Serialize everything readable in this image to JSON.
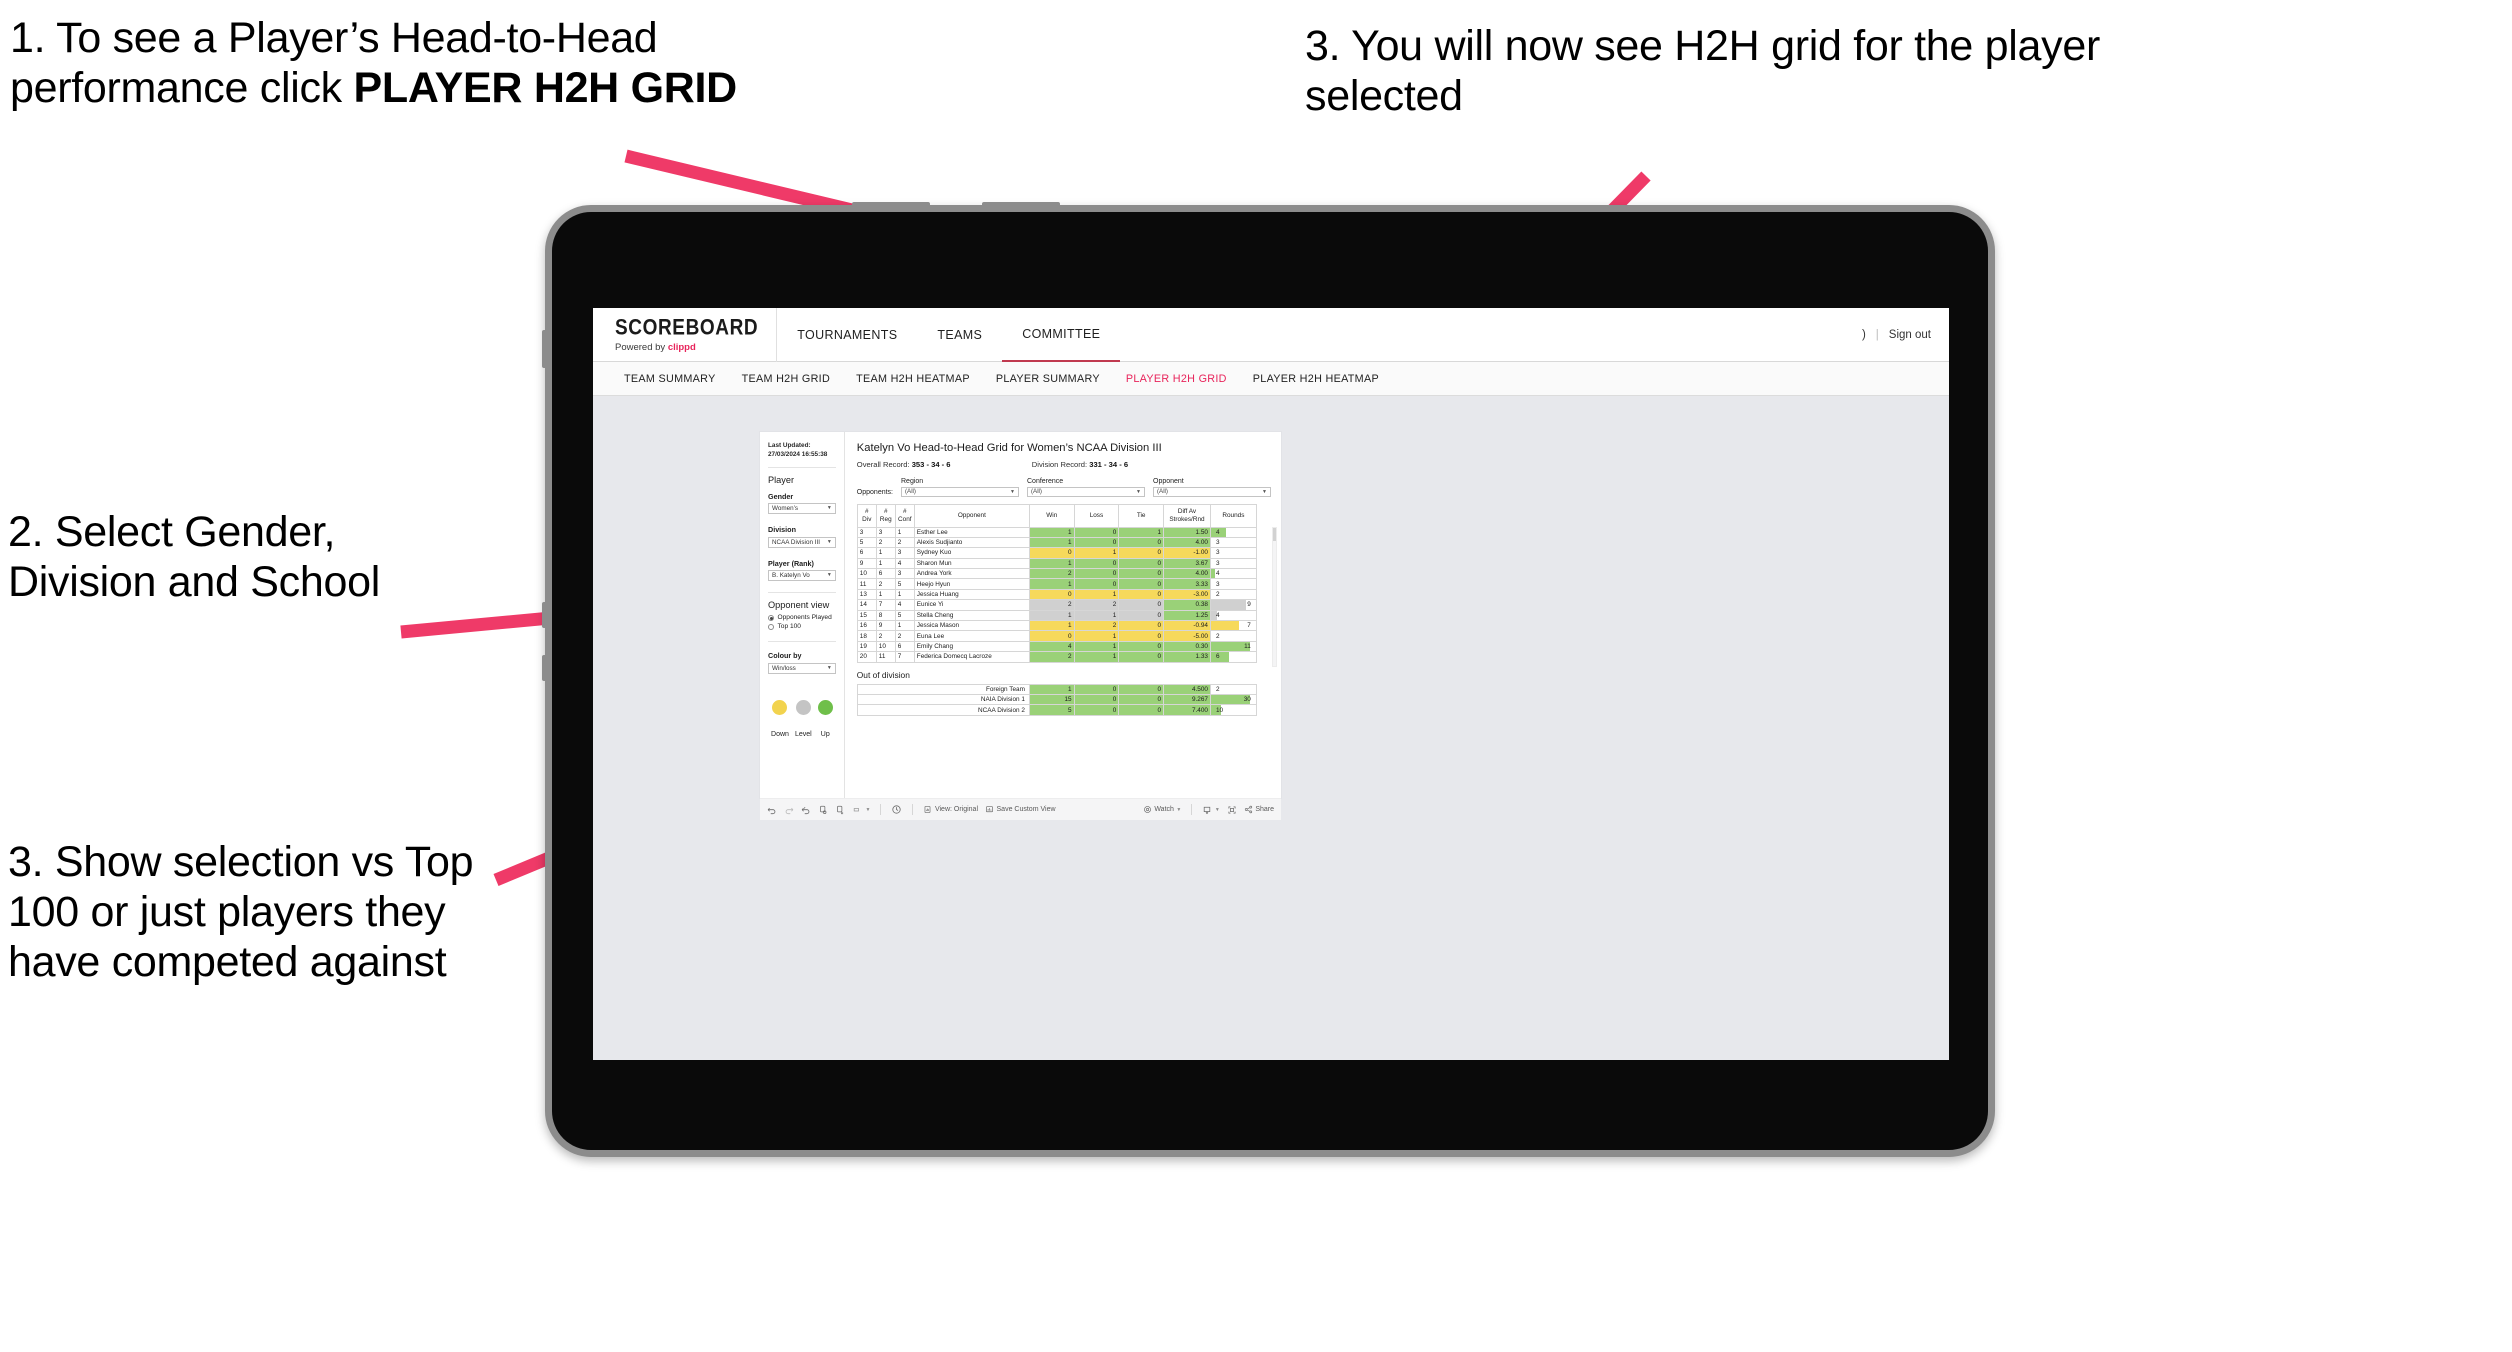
{
  "annotations": [
    {
      "id": "step1",
      "pre": "1. To see a Player’s Head-to-Head performance click ",
      "bold": "PLAYER H2H GRID"
    },
    {
      "id": "step2",
      "text": "2. Select Gender, Division and School"
    },
    {
      "id": "step3",
      "text": "3. Show selection vs Top 100 or just players they have competed against"
    },
    {
      "id": "step4",
      "text": "3. You will now see H2H grid for the player selected"
    }
  ],
  "arrow_color": "#ef3a68",
  "app": {
    "brand": {
      "name": "SCOREBOARD",
      "powered_prefix": "Powered by ",
      "powered_accent": "clippd"
    },
    "topnav": [
      {
        "label": "TOURNAMENTS",
        "active": false
      },
      {
        "label": "TEAMS",
        "active": false
      },
      {
        "label": "COMMITTEE",
        "active": true
      }
    ],
    "account": {
      "user": ")",
      "divider": "|",
      "signout": "Sign out"
    },
    "subnav": [
      {
        "label": "TEAM SUMMARY",
        "active": false
      },
      {
        "label": "TEAM H2H GRID",
        "active": false
      },
      {
        "label": "TEAM H2H HEATMAP",
        "active": false
      },
      {
        "label": "PLAYER SUMMARY",
        "active": false
      },
      {
        "label": "PLAYER H2H GRID",
        "active": true
      },
      {
        "label": "PLAYER H2H HEATMAP",
        "active": false
      }
    ]
  },
  "filters": {
    "last_updated": "Last Updated: 27/03/2024 16:55:38",
    "player_heading": "Player",
    "gender": {
      "label": "Gender",
      "value": "Women’s"
    },
    "division": {
      "label": "Division",
      "value": "NCAA Division III"
    },
    "player_rank": {
      "label": "Player (Rank)",
      "value": "B. Katelyn Vo"
    },
    "opponent_view": {
      "heading": "Opponent view",
      "options": [
        {
          "label": "Opponents Played",
          "selected": true
        },
        {
          "label": "Top 100",
          "selected": false
        }
      ]
    },
    "colour_by": {
      "label": "Colour by",
      "value": "Win/loss"
    },
    "legend": [
      {
        "label": "Down",
        "color": "#f2d34e"
      },
      {
        "label": "Level",
        "color": "#c4c4c4"
      },
      {
        "label": "Up",
        "color": "#6fbf4a"
      }
    ]
  },
  "viz": {
    "title": "Katelyn Vo Head-to-Head Grid for Women’s NCAA Division III",
    "overall_record_label": "Overall Record:",
    "overall_record_value": "353 - 34 - 6",
    "division_record_label": "Division Record:",
    "division_record_value": "331 - 34 - 6",
    "opponents_label": "Opponents:",
    "opponent_filters": [
      {
        "caption": "Region",
        "value": "(All)"
      },
      {
        "caption": "Conference",
        "value": "(All)"
      },
      {
        "caption": "Opponent",
        "value": "(All)"
      }
    ]
  },
  "chart_data": {
    "type": "table",
    "title": "Katelyn Vo Head-to-Head Grid for Women’s NCAA Division III",
    "columns": [
      "# Div",
      "# Reg",
      "# Conf",
      "Opponent",
      "Win",
      "Loss",
      "Tie",
      "Diff Av Strokes/Rnd",
      "Rounds"
    ],
    "column_header_lines": [
      [
        "#",
        "Div"
      ],
      [
        "#",
        "Reg"
      ],
      [
        "#",
        "Conf"
      ],
      [
        "Opponent"
      ],
      [
        "Win"
      ],
      [
        "Loss"
      ],
      [
        "Tie"
      ],
      [
        "Diff Av",
        "Strokes/Rnd"
      ],
      [
        "Rounds"
      ]
    ],
    "rows": [
      {
        "div": "3",
        "reg": "3",
        "conf": "1",
        "opponent": "Esther Lee",
        "win": "1",
        "loss": "0",
        "tie": "1",
        "diff": "1.50",
        "rounds": "4",
        "state": "up",
        "rounds_pct": 34
      },
      {
        "div": "5",
        "reg": "2",
        "conf": "2",
        "opponent": "Alexis Sudjianto",
        "win": "1",
        "loss": "0",
        "tie": "0",
        "diff": "4.00",
        "rounds": "3",
        "state": "up",
        "rounds_pct": 0
      },
      {
        "div": "6",
        "reg": "1",
        "conf": "3",
        "opponent": "Sydney Kuo",
        "win": "0",
        "loss": "1",
        "tie": "0",
        "diff": "-1.00",
        "rounds": "3",
        "state": "down",
        "rounds_pct": 0
      },
      {
        "div": "9",
        "reg": "1",
        "conf": "4",
        "opponent": "Sharon Mun",
        "win": "1",
        "loss": "0",
        "tie": "0",
        "diff": "3.67",
        "rounds": "3",
        "state": "up",
        "rounds_pct": 0
      },
      {
        "div": "10",
        "reg": "6",
        "conf": "3",
        "opponent": "Andrea York",
        "win": "2",
        "loss": "0",
        "tie": "0",
        "diff": "4.00",
        "rounds": "4",
        "state": "up",
        "rounds_pct": 8
      },
      {
        "div": "11",
        "reg": "2",
        "conf": "5",
        "opponent": "Heejo Hyun",
        "win": "1",
        "loss": "0",
        "tie": "0",
        "diff": "3.33",
        "rounds": "3",
        "state": "up",
        "rounds_pct": 0
      },
      {
        "div": "13",
        "reg": "1",
        "conf": "1",
        "opponent": "Jessica Huang",
        "win": "0",
        "loss": "1",
        "tie": "0",
        "diff": "-3.00",
        "rounds": "2",
        "state": "down",
        "rounds_pct": 0
      },
      {
        "div": "14",
        "reg": "7",
        "conf": "4",
        "opponent": "Eunice Yi",
        "win": "2",
        "loss": "2",
        "tie": "0",
        "diff": "0.38",
        "rounds": "9",
        "state": "level",
        "rounds_pct": 78,
        "diff_state": "up",
        "rounds_state": "level"
      },
      {
        "div": "15",
        "reg": "8",
        "conf": "5",
        "opponent": "Stella Cheng",
        "win": "1",
        "loss": "1",
        "tie": "0",
        "diff": "1.25",
        "rounds": "4",
        "state": "level",
        "rounds_pct": 14,
        "diff_state": "up",
        "rounds_state": "level"
      },
      {
        "div": "16",
        "reg": "9",
        "conf": "1",
        "opponent": "Jessica Mason",
        "win": "1",
        "loss": "2",
        "tie": "0",
        "diff": "-0.94",
        "rounds": "7",
        "state": "down",
        "rounds_pct": 62
      },
      {
        "div": "18",
        "reg": "2",
        "conf": "2",
        "opponent": "Euna Lee",
        "win": "0",
        "loss": "1",
        "tie": "0",
        "diff": "-5.00",
        "rounds": "2",
        "state": "down",
        "rounds_pct": 0
      },
      {
        "div": "19",
        "reg": "10",
        "conf": "6",
        "opponent": "Emily Chang",
        "win": "4",
        "loss": "1",
        "tie": "0",
        "diff": "0.30",
        "rounds": "11",
        "state": "up",
        "rounds_pct": 88
      },
      {
        "div": "20",
        "reg": "11",
        "conf": "7",
        "opponent": "Federica Domecq Lacroze",
        "win": "2",
        "loss": "1",
        "tie": "0",
        "diff": "1.33",
        "rounds": "6",
        "state": "up",
        "rounds_pct": 40
      }
    ],
    "out_of_division": {
      "title": "Out of division",
      "rows": [
        {
          "label": "Foreign Team",
          "win": "1",
          "loss": "0",
          "tie": "0",
          "diff": "4.500",
          "rounds": "2",
          "state": "up",
          "rounds_pct": 0
        },
        {
          "label": "NAIA Division 1",
          "win": "15",
          "loss": "0",
          "tie": "0",
          "diff": "9.267",
          "rounds": "30",
          "state": "up",
          "rounds_pct": 88
        },
        {
          "label": "NCAA Division 2",
          "win": "5",
          "loss": "0",
          "tie": "0",
          "diff": "7.400",
          "rounds": "10",
          "state": "up",
          "rounds_pct": 22
        }
      ]
    },
    "colors": {
      "up": "#9ad178",
      "down": "#f6d95b",
      "level": "#d0d0d0"
    }
  },
  "toolbar": {
    "items": [
      {
        "name": "undo-icon",
        "label": ""
      },
      {
        "name": "redo-icon",
        "label": ""
      },
      {
        "name": "revert-icon",
        "label": ""
      },
      {
        "name": "refresh-data-icon",
        "label": ""
      },
      {
        "name": "pause-updates-icon",
        "label": ""
      },
      {
        "name": "highlight-icon",
        "label": ""
      }
    ],
    "view_original": "View: Original",
    "save_custom_view": "Save Custom View",
    "watch": "Watch",
    "share": "Share"
  }
}
